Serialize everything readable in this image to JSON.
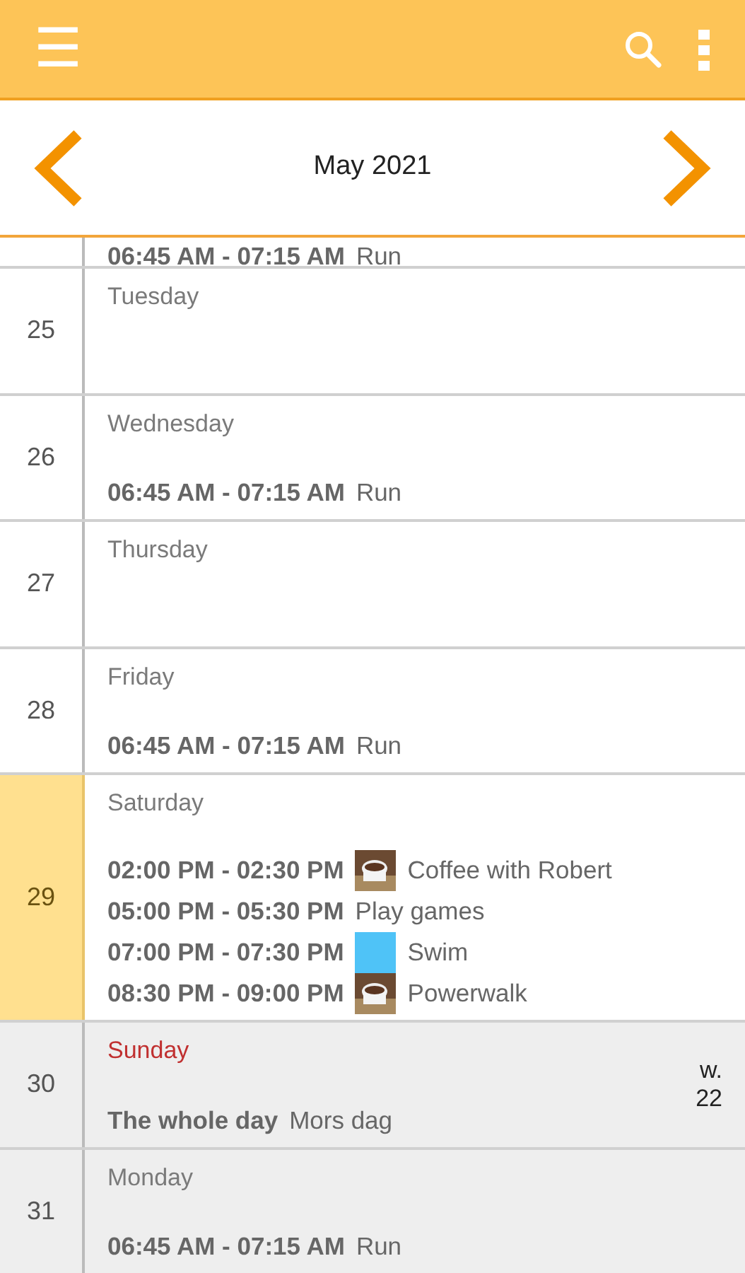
{
  "toolbar": {
    "menu": "☰"
  },
  "month_nav": {
    "title": "May 2021"
  },
  "days": [
    {
      "selected": false,
      "shaded": false,
      "partial": true,
      "events": [
        {
          "time": "06:45 AM - 07:15 AM",
          "title": "Run",
          "kind": "plain"
        }
      ]
    },
    {
      "number": "25",
      "weekday": "Tuesday",
      "selected": false,
      "shaded": false,
      "holiday": false
    },
    {
      "number": "26",
      "weekday": "Wednesday",
      "selected": false,
      "shaded": false,
      "holiday": false,
      "events": [
        {
          "time": "06:45 AM - 07:15 AM",
          "title": "Run",
          "kind": "plain"
        }
      ]
    },
    {
      "number": "27",
      "weekday": "Thursday",
      "selected": false,
      "shaded": false,
      "holiday": false
    },
    {
      "number": "28",
      "weekday": "Friday",
      "selected": false,
      "shaded": false,
      "holiday": false,
      "events": [
        {
          "time": "06:45 AM - 07:15 AM",
          "title": "Run",
          "kind": "plain"
        }
      ]
    },
    {
      "number": "29",
      "weekday": "Saturday",
      "selected": true,
      "shaded": false,
      "holiday": false,
      "events": [
        {
          "time": "02:00 PM - 02:30 PM",
          "title": "Coffee with Robert"
        },
        {
          "time": "05:00 PM - 05:30 PM",
          "title": "Play games",
          "kind": "plain"
        },
        {
          "time": "07:00 PM - 07:30 PM",
          "title": "Swim",
          "kind": "swatch",
          "color": "#4fc3f7"
        },
        {
          "time": "08:30 PM - 09:00 PM",
          "title": "Powerwalk"
        }
      ]
    },
    {
      "number": "30",
      "weekday": "Sunday",
      "selected": false,
      "shaded": true,
      "holiday": true,
      "week": "w. 22",
      "events": [
        {
          "time": "The whole day",
          "title": "Mors dag",
          "kind": "plain"
        }
      ]
    },
    {
      "number": "31",
      "weekday": "Monday",
      "selected": false,
      "shaded": true,
      "holiday": false,
      "events": [
        {
          "time": "06:45 AM - 07:15 AM",
          "title": "Run",
          "kind": "plain"
        }
      ]
    }
  ]
}
